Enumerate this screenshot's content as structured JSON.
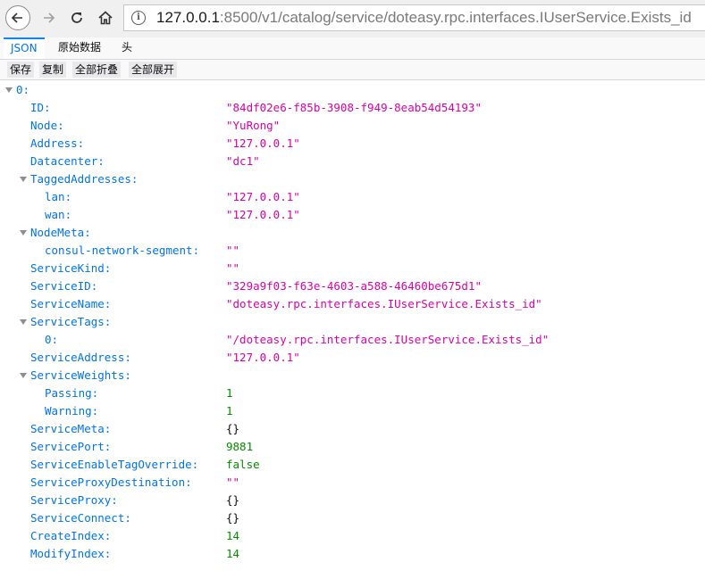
{
  "browser": {
    "url_host": "127.0.0.1",
    "url_rest": ":8500/v1/catalog/service/doteasy.rpc.interfaces.IUserService.Exists_id"
  },
  "viewer_tabs": [
    "JSON",
    "原始数据",
    "头"
  ],
  "toolbar": [
    "保存",
    "复制",
    "全部折叠",
    "全部展开"
  ],
  "json_tree": [
    {
      "key": "0:",
      "value": "",
      "type": "object"
    },
    {
      "key": "ID:",
      "value": "\"84df02e6-f85b-3908-f949-8eab54d54193\"",
      "type": "string"
    },
    {
      "key": "Node:",
      "value": "\"YuRong\"",
      "type": "string"
    },
    {
      "key": "Address:",
      "value": "\"127.0.0.1\"",
      "type": "string"
    },
    {
      "key": "Datacenter:",
      "value": "\"dc1\"",
      "type": "string"
    },
    {
      "key": "TaggedAddresses:",
      "value": "",
      "type": "object"
    },
    {
      "key": "lan:",
      "value": "\"127.0.0.1\"",
      "type": "string"
    },
    {
      "key": "wan:",
      "value": "\"127.0.0.1\"",
      "type": "string"
    },
    {
      "key": "NodeMeta:",
      "value": "",
      "type": "object"
    },
    {
      "key": "consul-network-segment:",
      "value": "\"\"",
      "type": "string"
    },
    {
      "key": "ServiceKind:",
      "value": "\"\"",
      "type": "string"
    },
    {
      "key": "ServiceID:",
      "value": "\"329a9f03-f63e-4603-a588-46460be675d1\"",
      "type": "string"
    },
    {
      "key": "ServiceName:",
      "value": "\"doteasy.rpc.interfaces.IUserService.Exists_id\"",
      "type": "string"
    },
    {
      "key": "ServiceTags:",
      "value": "",
      "type": "object"
    },
    {
      "key": "0:",
      "value": "\"/doteasy.rpc.interfaces.IUserService.Exists_id\"",
      "type": "string"
    },
    {
      "key": "ServiceAddress:",
      "value": "\"127.0.0.1\"",
      "type": "string"
    },
    {
      "key": "ServiceWeights:",
      "value": "",
      "type": "object"
    },
    {
      "key": "Passing:",
      "value": "1",
      "type": "number"
    },
    {
      "key": "Warning:",
      "value": "1",
      "type": "number"
    },
    {
      "key": "ServiceMeta:",
      "value": "{}",
      "type": "empty"
    },
    {
      "key": "ServicePort:",
      "value": "9881",
      "type": "number"
    },
    {
      "key": "ServiceEnableTagOverride:",
      "value": "false",
      "type": "bool"
    },
    {
      "key": "ServiceProxyDestination:",
      "value": "\"\"",
      "type": "string"
    },
    {
      "key": "ServiceProxy:",
      "value": "{}",
      "type": "empty"
    },
    {
      "key": "ServiceConnect:",
      "value": "{}",
      "type": "empty"
    },
    {
      "key": "CreateIndex:",
      "value": "14",
      "type": "number"
    },
    {
      "key": "ModifyIndex:",
      "value": "14",
      "type": "number"
    }
  ]
}
